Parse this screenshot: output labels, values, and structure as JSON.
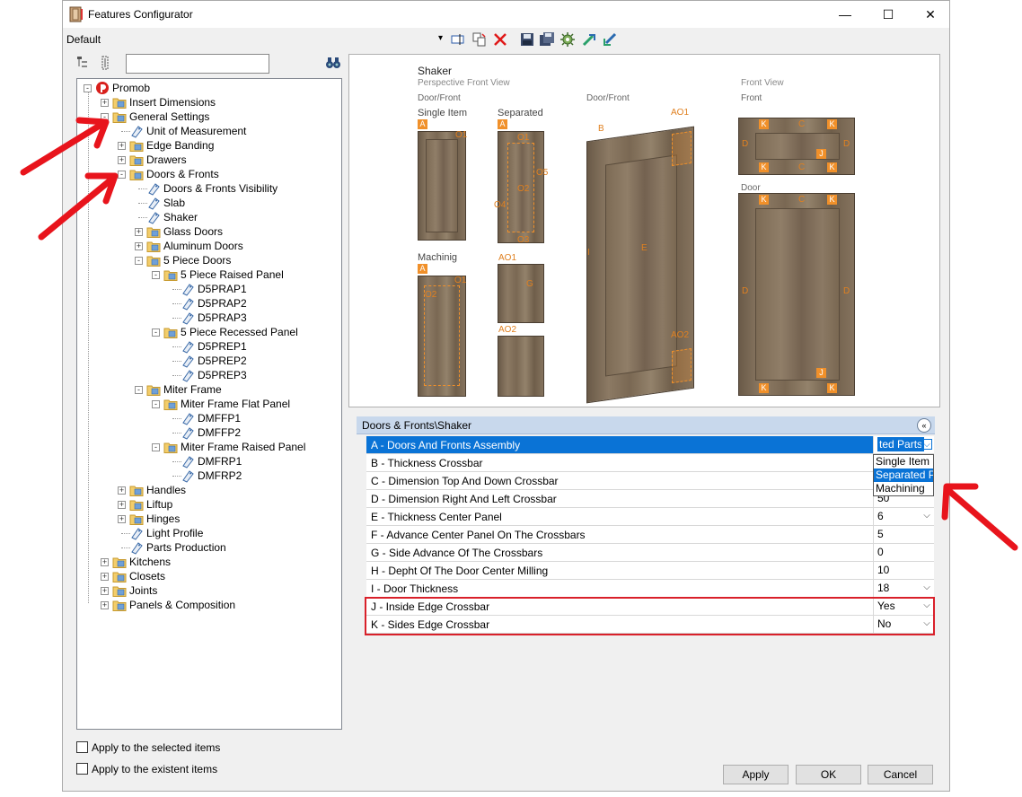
{
  "window": {
    "title": "Features Configurator",
    "minimize_glyph": "—",
    "maximize_glyph": "☐",
    "close_glyph": "✕"
  },
  "toolbar": {
    "profile": "Default",
    "dropdown_glyph": "▾"
  },
  "tree_search": {
    "placeholder": "",
    "value": ""
  },
  "tree": [
    {
      "label": "Promob",
      "icon": "promob-logo-icon",
      "level": 0,
      "expander": "-"
    },
    {
      "label": "Insert Dimensions",
      "icon": "folder-icon",
      "level": 1,
      "expander": "+"
    },
    {
      "label": "General Settings",
      "icon": "folder-icon",
      "level": 1,
      "expander": "-"
    },
    {
      "label": "Unit of Measurement",
      "icon": "tag-icon",
      "level": 2,
      "expander": ""
    },
    {
      "label": "Edge Banding",
      "icon": "folder-icon",
      "level": 2,
      "expander": "+"
    },
    {
      "label": "Drawers",
      "icon": "folder-icon",
      "level": 2,
      "expander": "+"
    },
    {
      "label": "Doors & Fronts",
      "icon": "folder-icon",
      "level": 2,
      "expander": "-"
    },
    {
      "label": "Doors & Fronts Visibility",
      "icon": "tag-icon",
      "level": 3,
      "expander": ""
    },
    {
      "label": "Slab",
      "icon": "tag-icon",
      "level": 3,
      "expander": ""
    },
    {
      "label": "Shaker",
      "icon": "tag-icon",
      "level": 3,
      "expander": ""
    },
    {
      "label": "Glass Doors",
      "icon": "folder-icon",
      "level": 3,
      "expander": "+"
    },
    {
      "label": "Aluminum Doors",
      "icon": "folder-icon",
      "level": 3,
      "expander": "+"
    },
    {
      "label": "5 Piece Doors",
      "icon": "folder-icon",
      "level": 3,
      "expander": "-"
    },
    {
      "label": "5 Piece Raised Panel",
      "icon": "folder-icon",
      "level": 4,
      "expander": "-"
    },
    {
      "label": "D5PRAP1",
      "icon": "tag-icon",
      "level": 5,
      "expander": ""
    },
    {
      "label": "D5PRAP2",
      "icon": "tag-icon",
      "level": 5,
      "expander": ""
    },
    {
      "label": "D5PRAP3",
      "icon": "tag-icon",
      "level": 5,
      "expander": ""
    },
    {
      "label": "5 Piece Recessed Panel",
      "icon": "folder-icon",
      "level": 4,
      "expander": "-"
    },
    {
      "label": "D5PREP1",
      "icon": "tag-icon",
      "level": 5,
      "expander": ""
    },
    {
      "label": "D5PREP2",
      "icon": "tag-icon",
      "level": 5,
      "expander": ""
    },
    {
      "label": "D5PREP3",
      "icon": "tag-icon",
      "level": 5,
      "expander": ""
    },
    {
      "label": "Miter Frame",
      "icon": "folder-icon",
      "level": 3,
      "expander": "-"
    },
    {
      "label": "Miter Frame Flat Panel",
      "icon": "folder-icon",
      "level": 4,
      "expander": "-"
    },
    {
      "label": "DMFFP1",
      "icon": "tag-icon",
      "level": 5,
      "expander": ""
    },
    {
      "label": "DMFFP2",
      "icon": "tag-icon",
      "level": 5,
      "expander": ""
    },
    {
      "label": "Miter Frame Raised Panel",
      "icon": "folder-icon",
      "level": 4,
      "expander": "-"
    },
    {
      "label": "DMFRP1",
      "icon": "tag-icon",
      "level": 5,
      "expander": ""
    },
    {
      "label": "DMFRP2",
      "icon": "tag-icon",
      "level": 5,
      "expander": ""
    },
    {
      "label": "Handles",
      "icon": "folder-icon",
      "level": 2,
      "expander": "+"
    },
    {
      "label": "Liftup",
      "icon": "folder-icon",
      "level": 2,
      "expander": "+"
    },
    {
      "label": "Hinges",
      "icon": "folder-icon",
      "level": 2,
      "expander": "+"
    },
    {
      "label": "Light Profile",
      "icon": "tag-icon",
      "level": 2,
      "expander": ""
    },
    {
      "label": "Parts Production",
      "icon": "tag-icon",
      "level": 2,
      "expander": ""
    },
    {
      "label": "Kitchens",
      "icon": "folder-icon",
      "level": 1,
      "expander": "+"
    },
    {
      "label": "Closets",
      "icon": "folder-icon",
      "level": 1,
      "expander": "+"
    },
    {
      "label": "Joints",
      "icon": "folder-icon",
      "level": 1,
      "expander": "+"
    },
    {
      "label": "Panels & Composition",
      "icon": "folder-icon",
      "level": 1,
      "expander": "+"
    }
  ],
  "preview": {
    "title": "Shaker",
    "subtitle_left": "Perspective Front View",
    "subtitle_right": "Front View",
    "col_door_front_1": "Door/Front",
    "col_door_front_2": "Door/Front",
    "col_front": "Front",
    "label_single_item": "Single Item",
    "label_separated": "Separated",
    "label_machining": "Machinig",
    "label_door": "Door",
    "tag_a": "A",
    "ann": {
      "o1": "O1",
      "o2": "O2",
      "o3": "O3",
      "o4": "O4",
      "o5": "O5",
      "ao1": "AO1",
      "ao2": "AO2",
      "b": "B",
      "e": "E",
      "i": "I",
      "k": "K",
      "c": "C",
      "d": "D",
      "j": "J",
      "g": "G"
    }
  },
  "properties": {
    "header": "Doors & Fronts\\Shaker",
    "collapse_glyph": "«",
    "rows": [
      {
        "name": "A - Doors And Fronts Assembly",
        "value": "ted Parts",
        "dropdown": true
      },
      {
        "name": "B - Thickness Crossbar",
        "value": "",
        "dropdown": false
      },
      {
        "name": "C - Dimension Top And Down Crossbar",
        "value": "",
        "dropdown": false
      },
      {
        "name": "D - Dimension Right And Left Crossbar",
        "value": "50",
        "dropdown": false
      },
      {
        "name": "E - Thickness Center Panel",
        "value": "6",
        "dropdown": true
      },
      {
        "name": "F - Advance Center Panel On The Crossbars",
        "value": "5",
        "dropdown": false
      },
      {
        "name": "G - Side Advance Of The Crossbars",
        "value": "0",
        "dropdown": false
      },
      {
        "name": "H - Depht Of The Door Center Milling",
        "value": "10",
        "dropdown": false
      },
      {
        "name": "I - Door Thickness",
        "value": "18",
        "dropdown": true
      },
      {
        "name": "J - Inside Edge Crossbar",
        "value": "Yes",
        "dropdown": true
      },
      {
        "name": "K - Sides Edge Crossbar",
        "value": "No",
        "dropdown": true
      }
    ],
    "dropdown_options": [
      "Single Item",
      "Separated Parts",
      "Machining"
    ],
    "dropdown_glyph": "⌵"
  },
  "options": {
    "apply_selected": "Apply to the selected items",
    "apply_existent": "Apply to the existent items"
  },
  "buttons": {
    "apply": "Apply",
    "ok": "OK",
    "cancel": "Cancel"
  },
  "colors": {
    "accent": "#0a73d6",
    "highlight_red": "#d9202a",
    "arrow_red": "#e8141c",
    "annotation_orange": "#f0902a"
  }
}
